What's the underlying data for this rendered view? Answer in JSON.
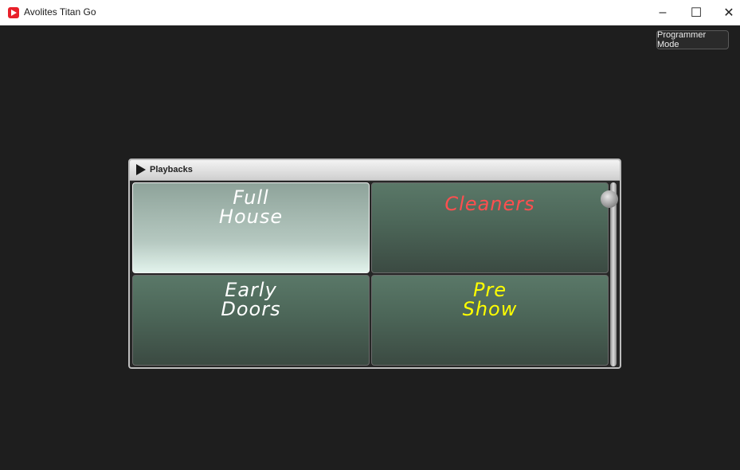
{
  "window": {
    "title": "Avolites Titan Go",
    "minimize_glyph": "–",
    "maximize_glyph": "☐",
    "close_glyph": "✕"
  },
  "toolbar": {
    "programmer_mode_label": "Programmer Mode"
  },
  "playbacks": {
    "title": "Playbacks",
    "tiles": [
      {
        "label": "Full\nHouse",
        "color": "#ffffff",
        "active": true
      },
      {
        "label": "Cleaners",
        "color": "#ff4f4f",
        "active": false
      },
      {
        "label": "Early\nDoors",
        "color": "#ffffff",
        "active": false
      },
      {
        "label": "Pre\nShow",
        "color": "#ffff00",
        "active": false
      }
    ]
  },
  "colors": {
    "accent": "#e8202a",
    "background": "#1e1e1e"
  }
}
